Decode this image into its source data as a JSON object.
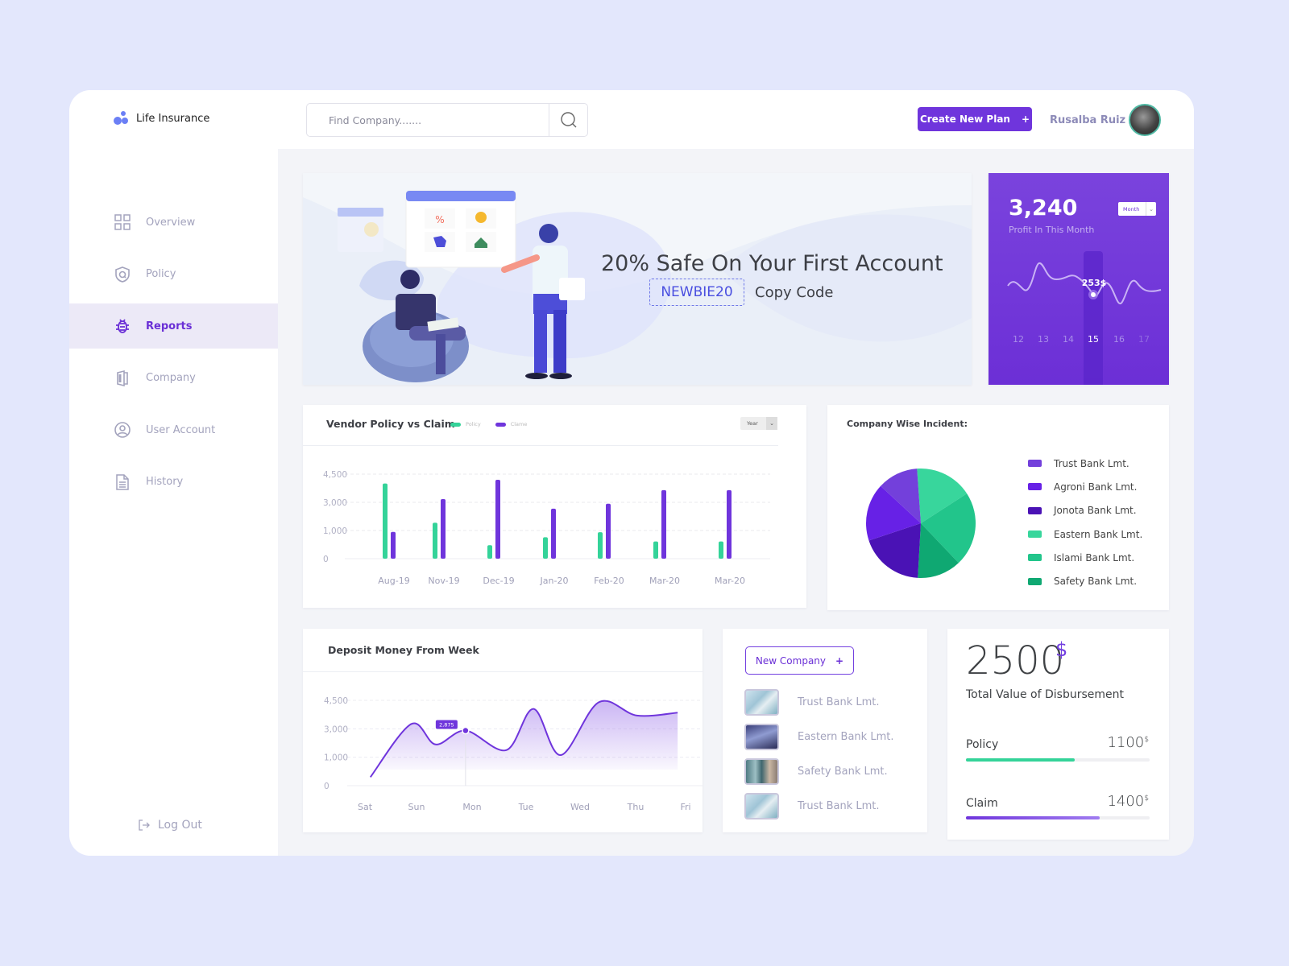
{
  "app": {
    "name": "Life Insurance",
    "brand_color": "#6f35dc"
  },
  "sidebar": {
    "items": [
      {
        "label": "Overview",
        "icon": "grid-icon",
        "active": false
      },
      {
        "label": "Policy",
        "icon": "shield-icon",
        "active": false
      },
      {
        "label": "Reports",
        "icon": "bug-icon",
        "active": true
      },
      {
        "label": "Company",
        "icon": "building-icon",
        "active": false
      },
      {
        "label": "User Account",
        "icon": "user-circle-icon",
        "active": false
      },
      {
        "label": "History",
        "icon": "document-icon",
        "active": false
      }
    ],
    "logout_label": "Log Out"
  },
  "topbar": {
    "search_placeholder": "Find Company.......",
    "create_button": "Create New Plan",
    "create_button_icon": "+",
    "user_name": "Rusalba Ruiz"
  },
  "banner": {
    "title": "20% Safe On Your First Account",
    "promo_code": "NEWBIE20",
    "copy_label": "Copy Code"
  },
  "profit": {
    "value": "3,240",
    "label": "Profit In This Month",
    "period_select": "Month",
    "tooltip": "253$",
    "days": [
      "12",
      "13",
      "14",
      "15",
      "16",
      "17"
    ],
    "selected_day": "15"
  },
  "vendor": {
    "title": "Vendor Policy vs Claim",
    "legend": [
      {
        "label": "Policy",
        "color": "#34d399"
      },
      {
        "label": "Clame",
        "color": "#6f35dc"
      }
    ],
    "period_select": "Year"
  },
  "incident": {
    "title": "Company Wise Incident:"
  },
  "deposit": {
    "title": "Deposit Money From Week",
    "tooltip": "2,875"
  },
  "companies": {
    "new_button": "New Company",
    "new_button_icon": "+",
    "list": [
      {
        "name": "Trust Bank Lmt.",
        "thumb": "glass-building-light"
      },
      {
        "name": "Eastern Bank Lmt.",
        "thumb": "city-towers-dark"
      },
      {
        "name": "Safety Bank Lmt.",
        "thumb": "glass-facade"
      },
      {
        "name": "Trust Bank Lmt.",
        "thumb": "glass-building-light"
      }
    ]
  },
  "disbursement": {
    "value": "2500",
    "currency": "$",
    "label": "Total Value of Disbursement",
    "items": [
      {
        "label": "Policy",
        "value": "1100",
        "currency": "$",
        "fraction": 0.59,
        "color": "#34d399"
      },
      {
        "label": "Claim",
        "value": "1400",
        "currency": "$",
        "fraction": 0.73,
        "color": "#6f35dc"
      }
    ]
  },
  "chart_data": [
    {
      "id": "vendor",
      "type": "bar",
      "title": "Vendor Policy vs Claim",
      "categories": [
        "Aug-19",
        "Nov-19",
        "Dec-19",
        "Jan-20",
        "Feb-20",
        "Mar-20",
        "Mar-20"
      ],
      "series": [
        {
          "name": "Policy",
          "color": "#34d399",
          "values": [
            4000,
            1550,
            480,
            760,
            940,
            610,
            610
          ]
        },
        {
          "name": "Clame",
          "color": "#6f35dc",
          "values": [
            950,
            3170,
            4200,
            2550,
            2900,
            3650,
            3650
          ]
        }
      ],
      "yticks": [
        0,
        1000,
        3000,
        4500
      ],
      "ytick_labels": [
        "0",
        "1,000",
        "3,000",
        "4,500"
      ],
      "grid": true,
      "legend": "top"
    },
    {
      "id": "incident",
      "type": "pie",
      "title": "Company Wise Incident:",
      "slices": [
        {
          "label": "Eastern Bank Lmt.",
          "value": 17,
          "color": "#38d69c"
        },
        {
          "label": "Islami Bank Lmt.",
          "value": 22,
          "color": "#22c58b"
        },
        {
          "label": "Safety Bank Lmt.",
          "value": 13,
          "color": "#0fa872"
        },
        {
          "label": "Jonota Bank Lmt.",
          "value": 19,
          "color": "#4a12b5"
        },
        {
          "label": "Agroni Bank Lmt.",
          "value": 17,
          "color": "#6721e6"
        },
        {
          "label": "Trust Bank Lmt.",
          "value": 12,
          "color": "#7340db"
        }
      ],
      "legend_order": [
        "Trust Bank Lmt.",
        "Agroni Bank Lmt.",
        "Jonota Bank Lmt.",
        "Eastern Bank Lmt.",
        "Islami Bank Lmt.",
        "Safety Bank Lmt."
      ],
      "legend": "right"
    },
    {
      "id": "deposit",
      "type": "area",
      "title": "Deposit Money From Week",
      "x": [
        "Sat",
        "Sun",
        "Mon",
        "Tue",
        "Wed",
        "Thu",
        "Fri"
      ],
      "points": [
        {
          "x": 0.1,
          "y": 300
        },
        {
          "x": 0.85,
          "y": 3250
        },
        {
          "x": 1.3,
          "y": 1900
        },
        {
          "x": 1.85,
          "y": 2875
        },
        {
          "x": 2.6,
          "y": 1500
        },
        {
          "x": 3.1,
          "y": 4050
        },
        {
          "x": 3.6,
          "y": 1150
        },
        {
          "x": 4.3,
          "y": 4400
        },
        {
          "x": 5.0,
          "y": 3700
        },
        {
          "x": 5.75,
          "y": 3850
        }
      ],
      "highlight": {
        "x": 1.85,
        "y": 2875,
        "label": "2,875"
      },
      "yticks": [
        0,
        1000,
        3000,
        4500
      ],
      "ytick_labels": [
        "0",
        "1,000",
        "3,000",
        "4,500"
      ],
      "grid": true
    },
    {
      "id": "profit",
      "type": "line",
      "title": "Profit In This Month",
      "x": [
        "12",
        "13",
        "14",
        "15",
        "16",
        "17"
      ],
      "highlight": {
        "x": "15",
        "label": "253$"
      }
    }
  ]
}
